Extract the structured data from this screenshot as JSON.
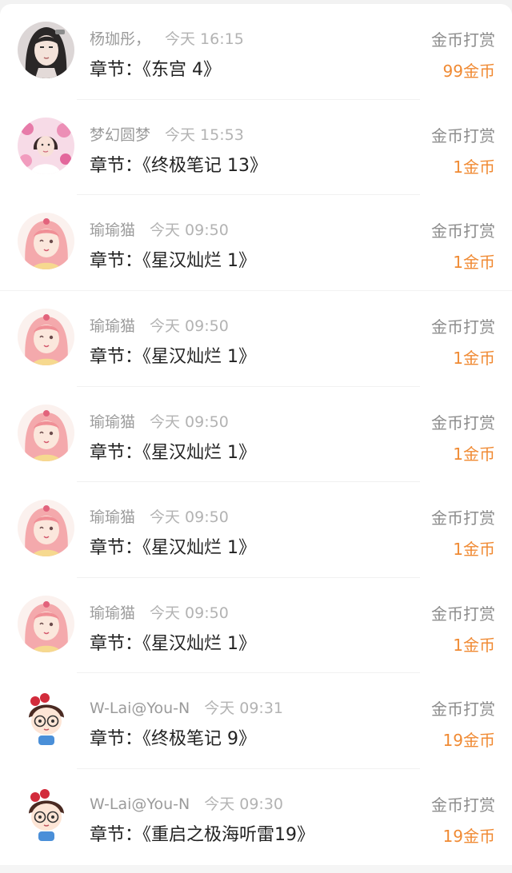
{
  "rewards": [
    {
      "name": "杨珈彤，",
      "time": "今天 16:15",
      "chapter_prefix": "章节：",
      "chapter": "《东宫 4》",
      "type": "金币打赏",
      "amount": "99金币",
      "avatar": "black-hair-anime-girl"
    },
    {
      "name": "梦幻圆梦",
      "time": "今天 15:53",
      "chapter_prefix": "章节：",
      "chapter": "《终极笔记 13》",
      "type": "金币打赏",
      "amount": "1金币",
      "avatar": "girl-in-pink-flowers"
    },
    {
      "name": "瑜瑜猫",
      "time": "今天 09:50",
      "chapter_prefix": "章节：",
      "chapter": "《星汉灿烂 1》",
      "type": "金币打赏",
      "amount": "1金币",
      "avatar": "pink-hair-anime-girl"
    },
    {
      "name": "瑜瑜猫",
      "time": "今天 09:50",
      "chapter_prefix": "章节：",
      "chapter": "《星汉灿烂 1》",
      "type": "金币打赏",
      "amount": "1金币",
      "avatar": "pink-hair-anime-girl"
    },
    {
      "name": "瑜瑜猫",
      "time": "今天 09:50",
      "chapter_prefix": "章节：",
      "chapter": "《星汉灿烂 1》",
      "type": "金币打赏",
      "amount": "1金币",
      "avatar": "pink-hair-anime-girl"
    },
    {
      "name": "瑜瑜猫",
      "time": "今天 09:50",
      "chapter_prefix": "章节：",
      "chapter": "《星汉灿烂 1》",
      "type": "金币打赏",
      "amount": "1金币",
      "avatar": "pink-hair-anime-girl"
    },
    {
      "name": "瑜瑜猫",
      "time": "今天 09:50",
      "chapter_prefix": "章节：",
      "chapter": "《星汉灿烂 1》",
      "type": "金币打赏",
      "amount": "1金币",
      "avatar": "pink-hair-anime-girl"
    },
    {
      "name": "W-Lai@You-N",
      "time": "今天 09:31",
      "chapter_prefix": "章节：",
      "chapter": "《终极笔记 9》",
      "type": "金币打赏",
      "amount": "19金币",
      "avatar": "cartoon-girl-with-glasses"
    },
    {
      "name": "W-Lai@You-N",
      "time": "今天 09:30",
      "chapter_prefix": "章节：",
      "chapter": "《重启之极海听雷19》",
      "type": "金币打赏",
      "amount": "19金币",
      "avatar": "cartoon-girl-with-glasses"
    }
  ],
  "colors": {
    "amount": "#f08a33",
    "name": "#9b9b9b",
    "title": "#222222",
    "background": "#f2f2f2"
  }
}
